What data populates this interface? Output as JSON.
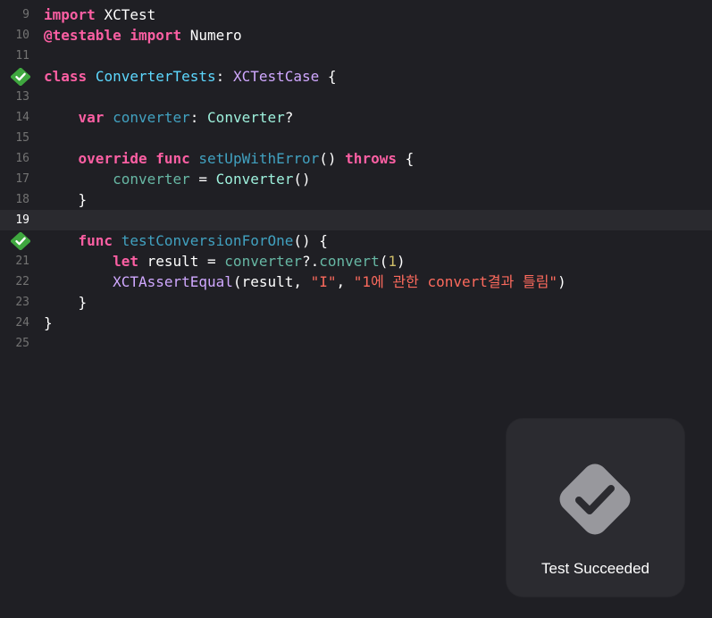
{
  "editor": {
    "lines": [
      {
        "num": "9",
        "tokens": [
          "import",
          " ",
          "XCTest"
        ]
      },
      {
        "num": "10",
        "tokens": [
          "@testable",
          " ",
          "import",
          " ",
          "Numero"
        ]
      },
      {
        "num": "11",
        "tokens": []
      },
      {
        "num": "12",
        "tokens": [
          "class",
          " ",
          "ConverterTests",
          ": ",
          "XCTestCase",
          " {"
        ]
      },
      {
        "num": "13",
        "tokens": []
      },
      {
        "num": "14",
        "tokens": [
          "    ",
          "var",
          " ",
          "converter",
          ": ",
          "Converter",
          "?"
        ]
      },
      {
        "num": "15",
        "tokens": []
      },
      {
        "num": "16",
        "tokens": [
          "    ",
          "override",
          " ",
          "func",
          " ",
          "setUpWithError",
          "() ",
          "throws",
          " {"
        ]
      },
      {
        "num": "17",
        "tokens": [
          "        ",
          "converter",
          " = ",
          "Converter",
          "()"
        ]
      },
      {
        "num": "18",
        "tokens": [
          "    }"
        ]
      },
      {
        "num": "19",
        "tokens": []
      },
      {
        "num": "20",
        "tokens": [
          "    ",
          "func",
          " ",
          "testConversionForOne",
          "() {"
        ]
      },
      {
        "num": "21",
        "tokens": [
          "        ",
          "let",
          " result = ",
          "converter",
          "?.",
          "convert",
          "(",
          "1",
          ")"
        ]
      },
      {
        "num": "22",
        "tokens": [
          "        ",
          "XCTAssertEqual",
          "(result, ",
          "\"I\"",
          ", ",
          "\"1에 관한 convert결과 틀림\"",
          ")"
        ]
      },
      {
        "num": "23",
        "tokens": [
          "    }"
        ]
      },
      {
        "num": "24",
        "tokens": [
          "}"
        ]
      },
      {
        "num": "25",
        "tokens": []
      }
    ],
    "current_line": "19",
    "passed_test_lines": [
      "12",
      "20"
    ]
  },
  "hud": {
    "label": "Test Succeeded",
    "icon": "checkmark-diamond-icon"
  },
  "colors": {
    "background": "#1f1f24",
    "current_line": "#2a2a2f",
    "keyword": "#fc5fa3",
    "type_declaration": "#5dd8ff",
    "type_reference": "#d0a8ff",
    "property": "#41a1c0",
    "other_type": "#9ef1dd",
    "string": "#fc6a5d",
    "number": "#d0bf69",
    "test_pass_green": "#3fa73f"
  }
}
